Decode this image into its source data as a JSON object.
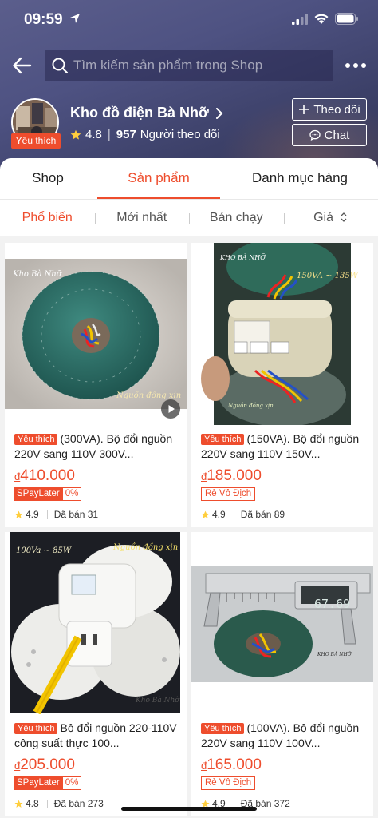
{
  "status_bar": {
    "time": "09:59"
  },
  "search": {
    "placeholder": "Tìm kiếm sản phẩm trong Shop"
  },
  "shop": {
    "name": "Kho đồ điện Bà Nhỡ",
    "badge": "Yêu thích",
    "rating": "4.8",
    "followers": "957",
    "followers_label": "Người theo dõi",
    "follow_label": "Theo dõi",
    "chat_label": "Chat"
  },
  "tabs": [
    {
      "label": "Shop",
      "active": false
    },
    {
      "label": "Sản phẩm",
      "active": true
    },
    {
      "label": "Danh mục hàng",
      "active": false
    }
  ],
  "sort": [
    {
      "label": "Phổ biến",
      "active": true
    },
    {
      "label": "Mới nhất",
      "active": false
    },
    {
      "label": "Bán chạy",
      "active": false
    },
    {
      "label": "Giá",
      "active": false
    }
  ],
  "products": [
    {
      "tag": "Yêu thích",
      "title": "(300VA). Bộ đổi nguồn 220V sang 110V 300V...",
      "currency": "đ",
      "price": "410.000",
      "promo_type": "spaylater",
      "promo_label": "SPayLater",
      "promo_pct": "0%",
      "rating": "4.9",
      "sold": "Đã bán 31",
      "img_caption_top": "Kho Bà Nhỡ",
      "img_caption_bottom": "Nguồn đồng xịn"
    },
    {
      "tag": "Yêu thích",
      "title": "(150VA). Bộ đổi nguồn 220V sang 110V 150V...",
      "currency": "đ",
      "price": "185.000",
      "promo_type": "rvd",
      "promo_label": "Rẻ Vô Địch",
      "rating": "4.9",
      "sold": "Đã bán 89",
      "img_caption_top": "KHO BÀ NHỠ",
      "img_caption_spec": "150VA ~ 135W",
      "img_caption_bottom": "Nguồn đồng xịn"
    },
    {
      "tag": "Yêu thích",
      "title": "Bộ đổi nguồn 220-110V công suất thực 100...",
      "currency": "đ",
      "price": "205.000",
      "promo_type": "spaylater",
      "promo_label": "SPayLater",
      "promo_pct": "0%",
      "rating": "4.8",
      "sold": "Đã bán 273",
      "img_caption_top": "100Va ~ 85W",
      "img_caption_spec": "Nguồn đồng xịn",
      "img_caption_bottom": "Kho Bà Nhỡ"
    },
    {
      "tag": "Yêu thích",
      "title": "(100VA). Bộ đổi nguồn 220V sang 110V 100V...",
      "currency": "đ",
      "price": "165.000",
      "promo_type": "rvd",
      "promo_label": "Rẻ Vô Địch",
      "rating": "4.9",
      "sold": "Đã bán 372",
      "img_caption_bottom": "KHO BÀ NHỠ",
      "img_readout": "67.69"
    }
  ],
  "colors": {
    "accent": "#ee4d2d",
    "header": "#4e5282"
  }
}
